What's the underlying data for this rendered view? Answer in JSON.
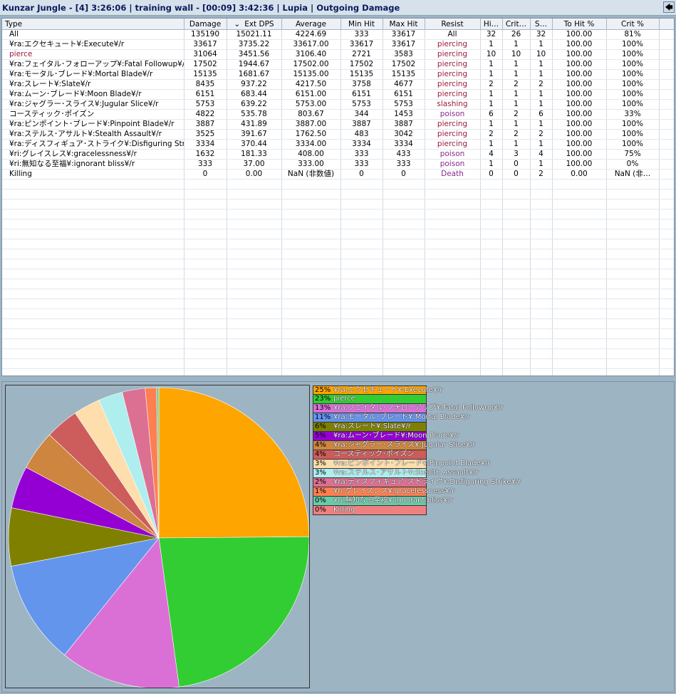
{
  "window": {
    "title": "Kunzar Jungle - [4] 3:26:06 | training wall  - [00:09] 3:42:36 | Lupia | Outgoing Damage",
    "back_glyph": "🡄"
  },
  "table": {
    "sort_glyph": "⌄",
    "columns": [
      "Type",
      "Damage",
      "Ext DPS",
      "Average",
      "Min Hit",
      "Max Hit",
      "Resist",
      "Hi…",
      "Crit…",
      "S…",
      "To Hit %",
      "Crit %"
    ],
    "rows": [
      [
        "All",
        "135190",
        "15021.11",
        "4224.69",
        "333",
        "33617",
        "All",
        "32",
        "26",
        "32",
        "100.00",
        "81%"
      ],
      [
        "¥ra:エクセキュート¥:Execute¥/r",
        "33617",
        "3735.22",
        "33617.00",
        "33617",
        "33617",
        "piercing",
        "1",
        "1",
        "1",
        "100.00",
        "100%"
      ],
      [
        "pierce",
        "31064",
        "3451.56",
        "3106.40",
        "2721",
        "3583",
        "piercing",
        "10",
        "10",
        "10",
        "100.00",
        "100%"
      ],
      [
        "¥ra:フェイタル･フォローアップ¥:Fatal Followup¥/r",
        "17502",
        "1944.67",
        "17502.00",
        "17502",
        "17502",
        "piercing",
        "1",
        "1",
        "1",
        "100.00",
        "100%"
      ],
      [
        "¥ra:モータル･ブレード¥:Mortal Blade¥/r",
        "15135",
        "1681.67",
        "15135.00",
        "15135",
        "15135",
        "piercing",
        "1",
        "1",
        "1",
        "100.00",
        "100%"
      ],
      [
        "¥ra:スレート¥:Slate¥/r",
        "8435",
        "937.22",
        "4217.50",
        "3758",
        "4677",
        "piercing",
        "2",
        "2",
        "2",
        "100.00",
        "100%"
      ],
      [
        "¥ra:ムーン･ブレード¥:Moon Blade¥/r",
        "6151",
        "683.44",
        "6151.00",
        "6151",
        "6151",
        "piercing",
        "1",
        "1",
        "1",
        "100.00",
        "100%"
      ],
      [
        "¥ra:ジャグラー･スライス¥:Jugular Slice¥/r",
        "5753",
        "639.22",
        "5753.00",
        "5753",
        "5753",
        "slashing",
        "1",
        "1",
        "1",
        "100.00",
        "100%"
      ],
      [
        "コースティック･ポイズン",
        "4822",
        "535.78",
        "803.67",
        "344",
        "1453",
        "poison",
        "6",
        "2",
        "6",
        "100.00",
        "33%"
      ],
      [
        "¥ra:ピンポイント･ブレード¥:Pinpoint Blade¥/r",
        "3887",
        "431.89",
        "3887.00",
        "3887",
        "3887",
        "piercing",
        "1",
        "1",
        "1",
        "100.00",
        "100%"
      ],
      [
        "¥ra:ステルス･アサルト¥:Stealth Assault¥/r",
        "3525",
        "391.67",
        "1762.50",
        "483",
        "3042",
        "piercing",
        "2",
        "2",
        "2",
        "100.00",
        "100%"
      ],
      [
        "¥ra:ディスフィギュア･ストライク¥:Disfiguring Strike¥/r",
        "3334",
        "370.44",
        "3334.00",
        "3334",
        "3334",
        "piercing",
        "1",
        "1",
        "1",
        "100.00",
        "100%"
      ],
      [
        "¥ri:グレイスレス¥:gracelessness¥/r",
        "1632",
        "181.33",
        "408.00",
        "333",
        "433",
        "poison",
        "4",
        "3",
        "4",
        "100.00",
        "75%"
      ],
      [
        "¥ri:無知なる至福¥:ignorant bliss¥/r",
        "333",
        "37.00",
        "333.00",
        "333",
        "333",
        "poison",
        "1",
        "0",
        "1",
        "100.00",
        "0%"
      ],
      [
        "Killing",
        "0",
        "0.00",
        "NaN (非数値)",
        "0",
        "0",
        "Death",
        "0",
        "0",
        "2",
        "0.00",
        "NaN (非…"
      ]
    ]
  },
  "chart_data": {
    "type": "pie",
    "slices": [
      {
        "label": "¥ra:エクセキュート¥:Execute¥/r",
        "pct": "25%",
        "value": 33617,
        "color": "#ffa500"
      },
      {
        "label": "pierce",
        "pct": "23%",
        "value": 31064,
        "color": "#32cd32"
      },
      {
        "label": "¥ra:フェイタル･フォローアップ¥:Fatal Followup¥/r",
        "pct": "13%",
        "value": 17502,
        "color": "#da70d6"
      },
      {
        "label": "¥ra:モータル･ブレード¥:Mortal Blade¥/r",
        "pct": "11%",
        "value": 15135,
        "color": "#6495ed"
      },
      {
        "label": "¥ra:スレート¥:Slate¥/r",
        "pct": "6%",
        "value": 8435,
        "color": "#808000"
      },
      {
        "label": "¥ra:ムーン･ブレード¥:Moon Blade¥/r",
        "pct": "5%",
        "value": 6151,
        "color": "#9400d3"
      },
      {
        "label": "¥ra:ジャグラー･スライス¥:Jugular Slice¥/r",
        "pct": "4%",
        "value": 5753,
        "color": "#cd853f"
      },
      {
        "label": "コースティック･ポイズン",
        "pct": "4%",
        "value": 4822,
        "color": "#cd5c5c"
      },
      {
        "label": "¥ra:ピンポイント･ブレード¥:Pinpoint Blade¥/r",
        "pct": "3%",
        "value": 3887,
        "color": "#ffdead"
      },
      {
        "label": "¥ra:ステルス･アサルト¥:Stealth Assault¥/r",
        "pct": "3%",
        "value": 3525,
        "color": "#afeeee"
      },
      {
        "label": "¥ra:ディスフィギュア･ストライク¥:Disfiguring Strike¥/r",
        "pct": "2%",
        "value": 3334,
        "color": "#db7093"
      },
      {
        "label": "¥ri:グレイスレス¥:gracelessness¥/r",
        "pct": "1%",
        "value": 1632,
        "color": "#ff7f50"
      },
      {
        "label": "¥ri:無知なる至福¥:ignorant bliss¥/r",
        "pct": "0%",
        "value": 333,
        "color": "#66cdaa"
      },
      {
        "label": "Killing",
        "pct": "0%",
        "value": 0,
        "color": "#f08080"
      }
    ]
  }
}
